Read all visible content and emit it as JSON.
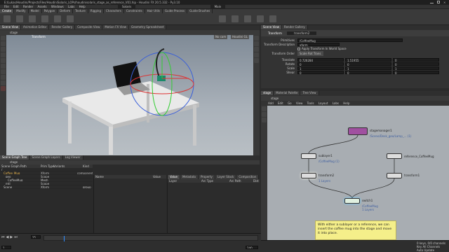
{
  "titlebar": {
    "path": "E:/Lukas/Houdini/ProjectsFiles/HoudiniSolaris_LOPs/houdinisolaris_stage_as_reference_V01.hip - Houdini FX 20.5.332 - Py3.10"
  },
  "menubar": {
    "items": [
      "File",
      "Edit",
      "Render",
      "Assets",
      "Windows",
      "Labs",
      "Help"
    ],
    "desktop": "Solaris",
    "network_type": "Main"
  },
  "shelf_tabs": [
    "Create",
    "Modify",
    "Model",
    "Polygon",
    "Deform",
    "Texture",
    "Rigging",
    "Characters",
    "Constraints",
    "Hair Utils",
    "Guide Process",
    "Guide Brushes",
    "Terrain FX",
    "Simple FX",
    "Volume",
    "LOP Lights and C...",
    "Karma",
    "USD",
    "Lighting"
  ],
  "left_tabs": [
    "Scene View",
    "Animation Editor",
    "Render Gallery",
    "Composite View",
    "Motion FX View",
    "Geometry Spreadsheet"
  ],
  "viewport": {
    "path": "stage",
    "label": "Transform",
    "camera_menu": "No cam",
    "renderer": "Houdini GL"
  },
  "scene_graph": {
    "tabs": [
      "Scene Graph Tree",
      "Scene Graph Layers",
      "Log Viewer"
    ],
    "path": "stage",
    "columns": [
      "Scene Graph Path",
      "Prim Type",
      "Variants",
      "Kind"
    ],
    "rows": [
      {
        "name": "/",
        "type": "",
        "kind": ""
      },
      {
        "name": "Coffee_Mug",
        "type": "Xform",
        "kind": "component"
      },
      {
        "name": "geo",
        "type": "Scope",
        "kind": ""
      },
      {
        "name": "CoffeeMug",
        "type": "Mesh",
        "kind": ""
      },
      {
        "name": "mtl",
        "type": "Scope",
        "kind": ""
      },
      {
        "name": "Scene",
        "type": "Xform",
        "kind": "group"
      }
    ],
    "detail_columns": [
      "Name",
      "Value"
    ],
    "right_tabs": [
      "Value",
      "Metadata",
      "Property",
      "Layer Stack",
      "Composition"
    ],
    "right_columns": [
      "Layer",
      "Arc Type",
      "Arc Path",
      "Dist"
    ]
  },
  "parameters": {
    "tabs": [
      "Scene View",
      "Render Gallery"
    ],
    "node_type": "Transform",
    "node_name": "transform2",
    "fields": [
      {
        "label": "Primitives",
        "value": "/CoffeeMug"
      },
      {
        "label": "Transform Description",
        "value": "xform"
      },
      {
        "label": "Apply Transform In World Space",
        "value": ""
      },
      {
        "label": "Transform Order",
        "value": "Scale Rot Trans"
      },
      {
        "label": "Translate",
        "value": "0.726284",
        "v2": "1.51955",
        "v3": "0"
      },
      {
        "label": "Rotate",
        "value": "0",
        "v2": "0",
        "v3": "0"
      },
      {
        "label": "Scale",
        "value": "1",
        "v2": "1",
        "v3": "1"
      },
      {
        "label": "Shear",
        "value": "0",
        "v2": "0",
        "v3": "0"
      }
    ]
  },
  "network": {
    "tabs": [
      "stage",
      "Material Palette",
      "Tree View"
    ],
    "path": "stage",
    "menu": [
      "Add",
      "Edit",
      "Go",
      "View",
      "Tools",
      "Layout",
      "Labs",
      "Help"
    ],
    "nodes": [
      {
        "name": "stagemanager1",
        "sub": "/Scene/Desk_geo/Lamp_... (1)"
      },
      {
        "name": "sublayer1",
        "sub": "/CoffeeMug (1)"
      },
      {
        "name": "reference_CoffeeMug",
        "sub": ""
      },
      {
        "name": "transform2",
        "sub": "1 Layers"
      },
      {
        "name": "transform1",
        "sub": ""
      },
      {
        "name": "switch1",
        "sub": "/CoffeeMug\n1 Layers"
      }
    ],
    "sticky_note": "With either a sublayer or a reference, we can insert the coffee mug into the stage and move it into place."
  },
  "timeline": {
    "frame": "25",
    "start": "1",
    "end": "240",
    "keys": "0 keys, 0/0 channels",
    "key_all": "Key All Channels",
    "auto_update": "Auto Update"
  }
}
